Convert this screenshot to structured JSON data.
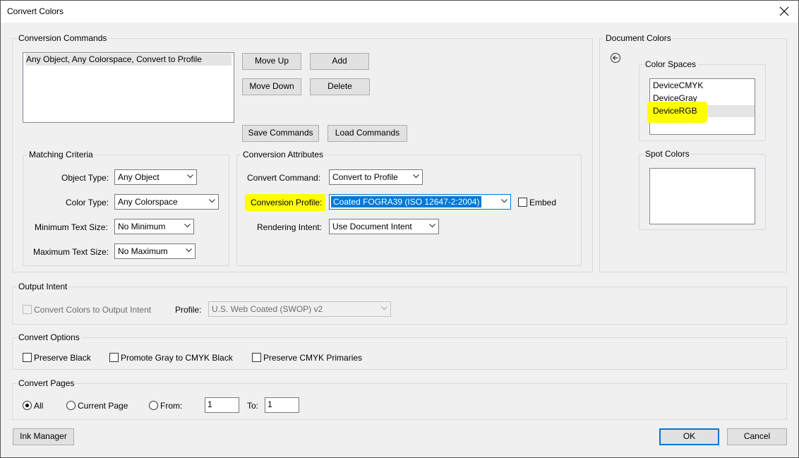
{
  "window": {
    "title": "Convert Colors"
  },
  "conversion_commands": {
    "label": "Conversion Commands",
    "items": [
      "Any Object, Any Colorspace, Convert to Profile"
    ],
    "move_up": "Move Up",
    "add": "Add",
    "move_down": "Move Down",
    "delete": "Delete",
    "save_commands": "Save Commands",
    "load_commands": "Load Commands"
  },
  "matching_criteria": {
    "label": "Matching Criteria",
    "object_type_label": "Object Type:",
    "object_type_value": "Any Object",
    "color_type_label": "Color Type:",
    "color_type_value": "Any Colorspace",
    "min_text_label": "Minimum Text Size:",
    "min_text_value": "No Minimum",
    "max_text_label": "Maximum Text Size:",
    "max_text_value": "No Maximum"
  },
  "conversion_attributes": {
    "label": "Conversion Attributes",
    "convert_command_label": "Convert Command:",
    "convert_command_value": "Convert to Profile",
    "conversion_profile_label": "Conversion Profile:",
    "conversion_profile_value": "Coated FOGRA39 (ISO 12647-2:2004)",
    "embed_label": "Embed",
    "rendering_intent_label": "Rendering Intent:",
    "rendering_intent_value": "Use Document Intent"
  },
  "document_colors": {
    "label": "Document Colors",
    "color_spaces_label": "Color Spaces",
    "color_spaces": [
      "DeviceCMYK",
      "DeviceGray",
      "DeviceRGB"
    ],
    "spot_colors_label": "Spot Colors"
  },
  "output_intent": {
    "label": "Output Intent",
    "convert_label": "Convert Colors to Output Intent",
    "profile_label": "Profile:",
    "profile_value": "U.S. Web Coated (SWOP) v2"
  },
  "convert_options": {
    "label": "Convert Options",
    "preserve_black": "Preserve Black",
    "promote_gray": "Promote Gray to CMYK Black",
    "preserve_cmyk": "Preserve CMYK Primaries"
  },
  "convert_pages": {
    "label": "Convert Pages",
    "all": "All",
    "current_page": "Current Page",
    "from_label": "From:",
    "from_value": "1",
    "to_label": "To:",
    "to_value": "1",
    "selected": "All"
  },
  "footer": {
    "ink_manager": "Ink Manager",
    "ok": "OK",
    "cancel": "Cancel"
  },
  "colors": {
    "highlight": "#ffff00",
    "selection": "#0078d7",
    "accent": "#0078d7"
  }
}
